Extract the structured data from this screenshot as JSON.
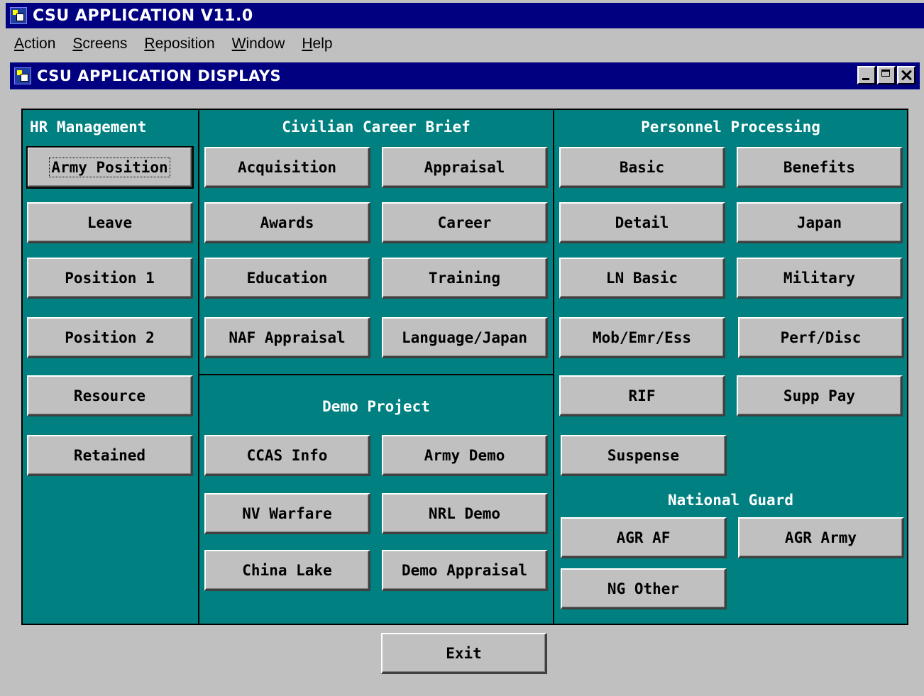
{
  "app": {
    "title": "CSU APPLICATION V11.0"
  },
  "menu": [
    "Action",
    "Screens",
    "Reposition",
    "Window",
    "Help"
  ],
  "window": {
    "title": "CSU APPLICATION DISPLAYS"
  },
  "sections": {
    "hr": {
      "title": "HR Management",
      "buttons": [
        "Army Position",
        "Leave",
        "Position 1",
        "Position 2",
        "Resource",
        "Retained"
      ]
    },
    "career": {
      "title": "Civilian Career Brief",
      "buttons": [
        "Acquisition",
        "Appraisal",
        "Awards",
        "Career",
        "Education",
        "Training",
        "NAF Appraisal",
        "Language/Japan"
      ]
    },
    "demo": {
      "title": "Demo Project",
      "buttons": [
        "CCAS Info",
        "Army Demo",
        "NV Warfare",
        "NRL Demo",
        "China Lake",
        "Demo Appraisal"
      ]
    },
    "personnel": {
      "title": "Personnel Processing",
      "buttons": [
        "Basic",
        "Benefits",
        "Detail",
        "Japan",
        "LN Basic",
        "Military",
        "Mob/Emr/Ess",
        "Perf/Disc",
        "RIF",
        "Supp Pay",
        "Suspense"
      ]
    },
    "guard": {
      "title": "National Guard",
      "buttons": [
        "AGR AF",
        "AGR Army",
        "NG Other"
      ]
    }
  },
  "exit_label": "Exit"
}
